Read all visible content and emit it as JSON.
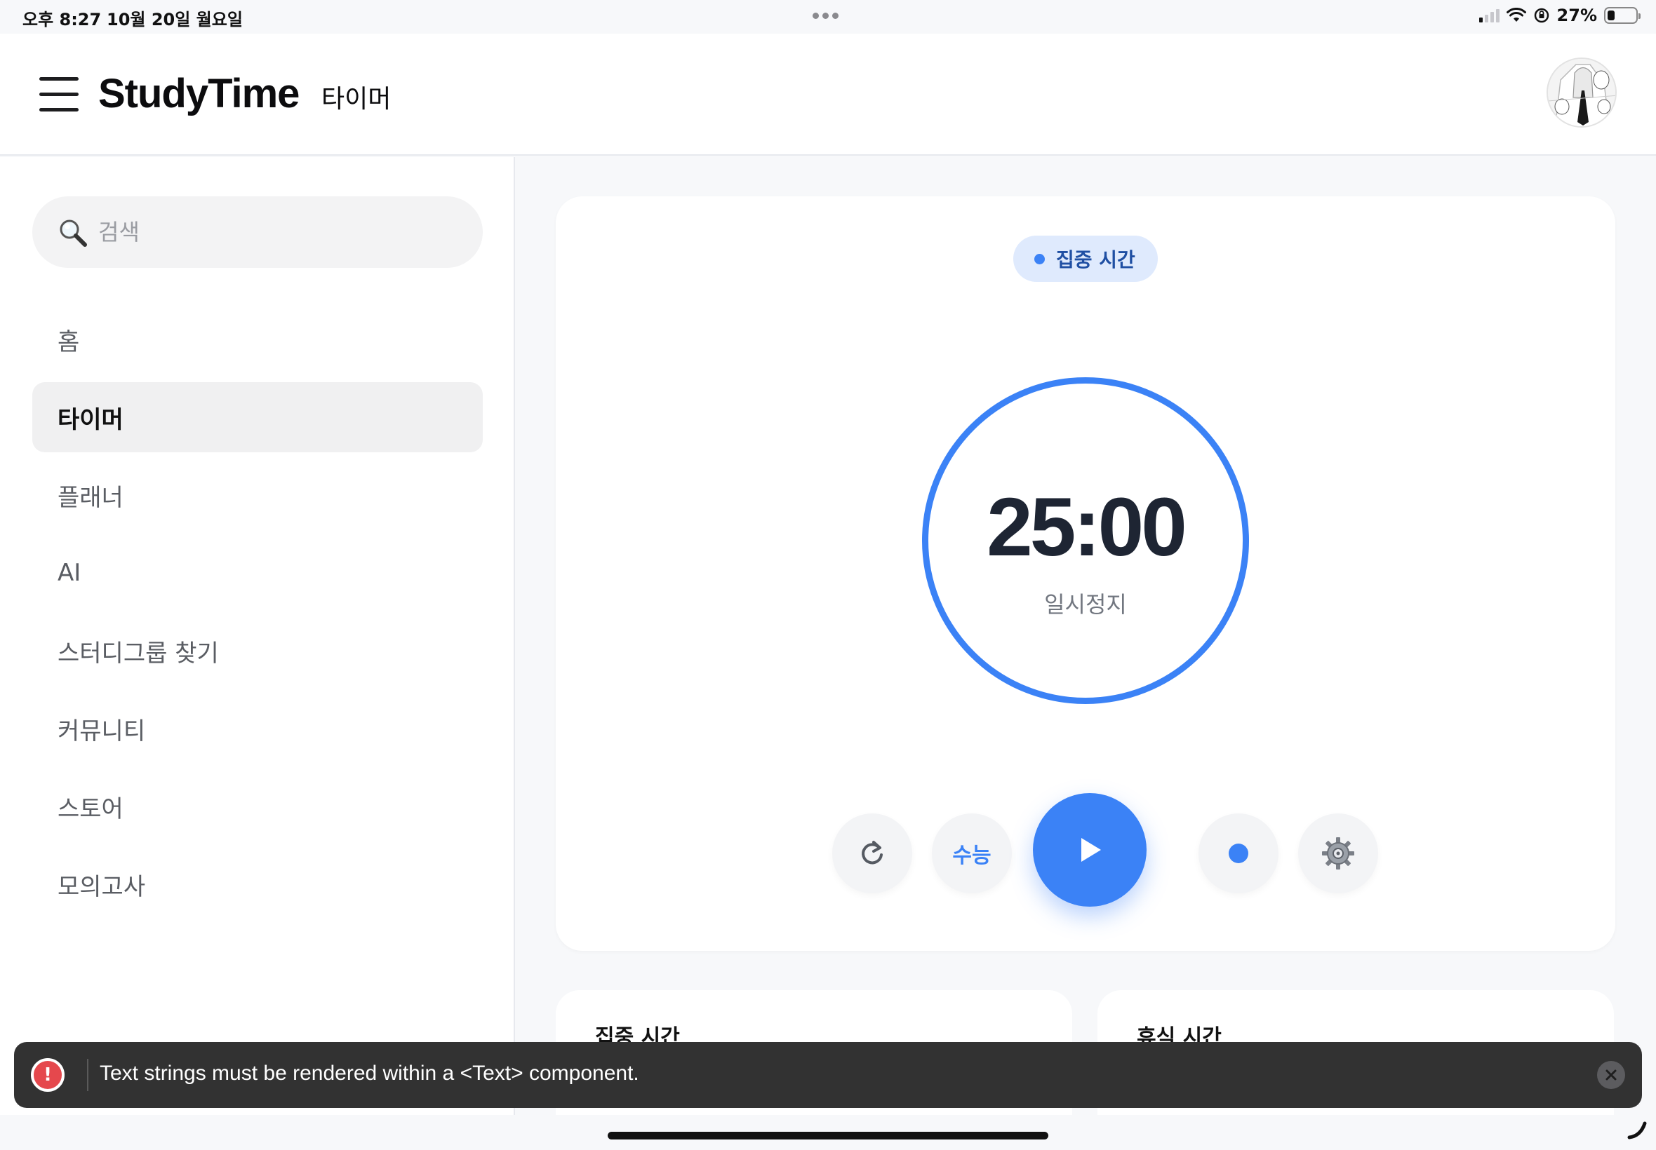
{
  "status_bar": {
    "time": "오후 8:27",
    "date": "10월 20일 월요일",
    "battery_percent": "27%",
    "battery_level": 0.27
  },
  "header": {
    "brand": "StudyTime",
    "page_title": "타이머",
    "avatar_icon": "avatar-image"
  },
  "sidebar": {
    "search": {
      "placeholder": "검색",
      "value": ""
    },
    "items": [
      {
        "label": "홈",
        "active": false
      },
      {
        "label": "타이머",
        "active": true
      },
      {
        "label": "플래너",
        "active": false
      },
      {
        "label": "AI",
        "active": false
      },
      {
        "label": "스터디그룹 찾기",
        "active": false
      },
      {
        "label": "커뮤니티",
        "active": false
      },
      {
        "label": "스토어",
        "active": false
      },
      {
        "label": "모의고사",
        "active": false
      }
    ]
  },
  "timer": {
    "mode_label": "집중 시간",
    "time": "25:00",
    "status": "일시정지",
    "progress": 1.0,
    "accent_color": "#3b82f6",
    "controls": {
      "reset_icon": "reset-icon",
      "preset_label": "수능",
      "play_icon": "play-icon",
      "record_icon": "record-dot-icon",
      "settings_icon": "gear-icon"
    }
  },
  "stats": {
    "focus_title": "집중 시간",
    "rest_title": "휴식 시간"
  },
  "toast": {
    "message": "Text strings must be rendered within a <Text> component.",
    "type": "error",
    "color": "#e5484d"
  }
}
